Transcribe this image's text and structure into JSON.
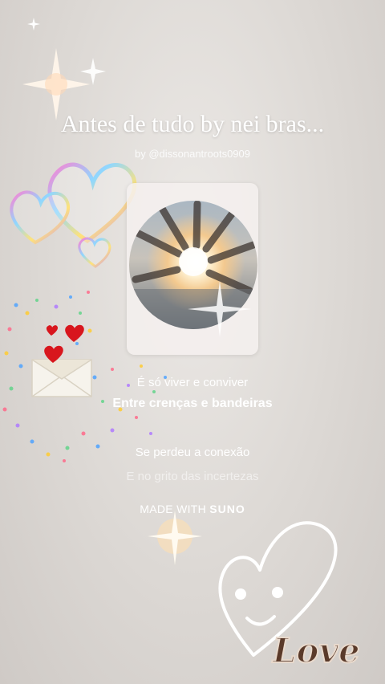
{
  "song": {
    "title": "Antes de tudo by nei bras...",
    "author": "by @dissonantroots0909"
  },
  "lyrics": [
    "É só viver e conviver",
    "Entre crenças e bandeiras",
    "Se perdeu a conexão",
    "E no grito das incertezas"
  ],
  "watermark": {
    "prefix": "MADE WITH",
    "brand": "SUNO"
  },
  "sticker": {
    "love_text": "Love"
  },
  "icons": {
    "cover": "hands-circle-image",
    "hearts": "bubble-hearts-sticker",
    "envelope": "love-letter-icon",
    "smiley": "smiley-heart-sticker",
    "sparkle": "sparkle-icon"
  }
}
